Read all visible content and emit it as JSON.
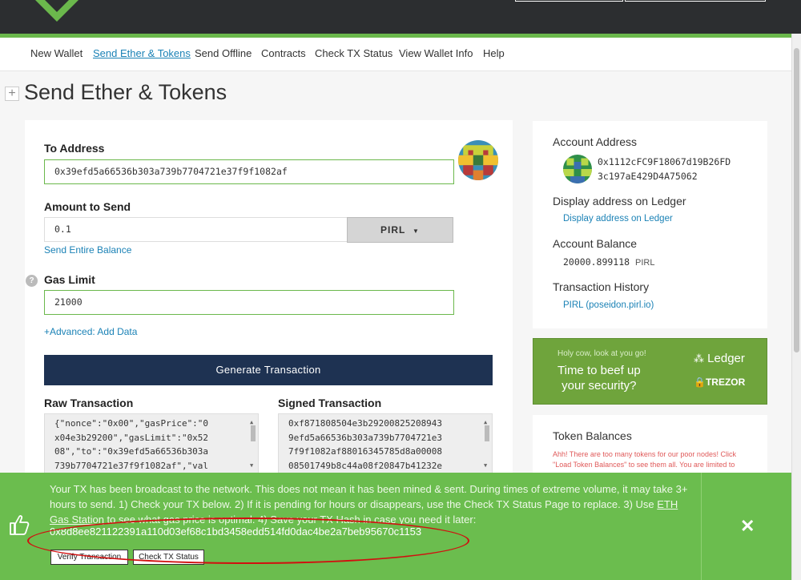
{
  "nav": {
    "items": [
      {
        "label": "New Wallet",
        "active": false
      },
      {
        "label": "Send Ether & Tokens",
        "active": true
      },
      {
        "label": "Send Offline",
        "active": false
      },
      {
        "label": "Contracts",
        "active": false
      },
      {
        "label": "Check TX Status",
        "active": false
      },
      {
        "label": "View Wallet Info",
        "active": false
      },
      {
        "label": "Help",
        "active": false
      }
    ]
  },
  "page": {
    "title": "Send Ether & Tokens",
    "expand_icon": "+"
  },
  "form": {
    "to_label": "To Address",
    "to_value": "0x39efd5a66536b303a739b7704721e37f9f1082af",
    "amount_label": "Amount to Send",
    "amount_value": "0.1",
    "currency": "PIRL",
    "send_entire": "Send Entire Balance",
    "gas_label": "Gas Limit",
    "gas_value": "21000",
    "advanced": "+Advanced: Add Data",
    "generate": "Generate Transaction",
    "raw_label": "Raw Transaction",
    "raw_lines": [
      "{\"nonce\":\"0x00\",\"gasPrice\":\"0",
      "x04e3b29200\",\"gasLimit\":\"0x52",
      "08\",\"to\":\"0x39efd5a66536b303a",
      "739b7704721e37f9f1082af\",\"val"
    ],
    "signed_label": "Signed Transaction",
    "signed_lines": [
      "0xf871808504e3b29200825208943",
      "9efd5a66536b303a739b7704721e3",
      "7f9f1082af88016345785d8a00008",
      "08501749b8c44a08f20847b41232e"
    ]
  },
  "side": {
    "account_address_label": "Account Address",
    "address_line1": "0x1112cFC9F18067d19B26FD",
    "address_line2": "3c197aE429D4A75062",
    "ledger_label": "Display address on Ledger",
    "ledger_link": "Display address on Ledger",
    "balance_label": "Account Balance",
    "balance_value": "20000.899118",
    "balance_unit": "PIRL",
    "history_label": "Transaction History",
    "history_link": "PIRL (poseidon.pirl.io)"
  },
  "promo": {
    "small": "Holy cow, look at you go!",
    "big_line1": "Time to beef up",
    "big_line2": "your security?",
    "ledger": "Ledger",
    "trezor": "TREZOR"
  },
  "tokens": {
    "title": "Token Balances",
    "note": "Ahh! There are too many tokens for our poor nodes! Click \"Load Token Balances\" to see them all. You are limited to"
  },
  "notification": {
    "line1": "Your TX has been broadcast to the network. This does not mean it has been mined & sent. During times of extreme volume, it may take 3+",
    "line2_a": "hours to send. 1) Check your TX below. 2) If it is pending for hours or disappears, use the Check TX Status Page to replace. 3) Use ",
    "line2_link": "ETH",
    "line3_link": "Gas Station",
    "line3_b": " to see what gas price is optimal. 4) Save your TX Hash in case you need it later:",
    "hash": "0x8d8ee821122391a110d03ef68c1bd3458edd514fd0dac4be2a7beb95670c1153",
    "verify_btn": "Verify Transaction",
    "status_btn": "Check TX Status",
    "close": "✕"
  },
  "colors": {
    "accent_green": "#6bbd4e",
    "link_blue": "#1b82b6",
    "navy": "#1e3252",
    "annotation_red": "#d10f0f"
  }
}
